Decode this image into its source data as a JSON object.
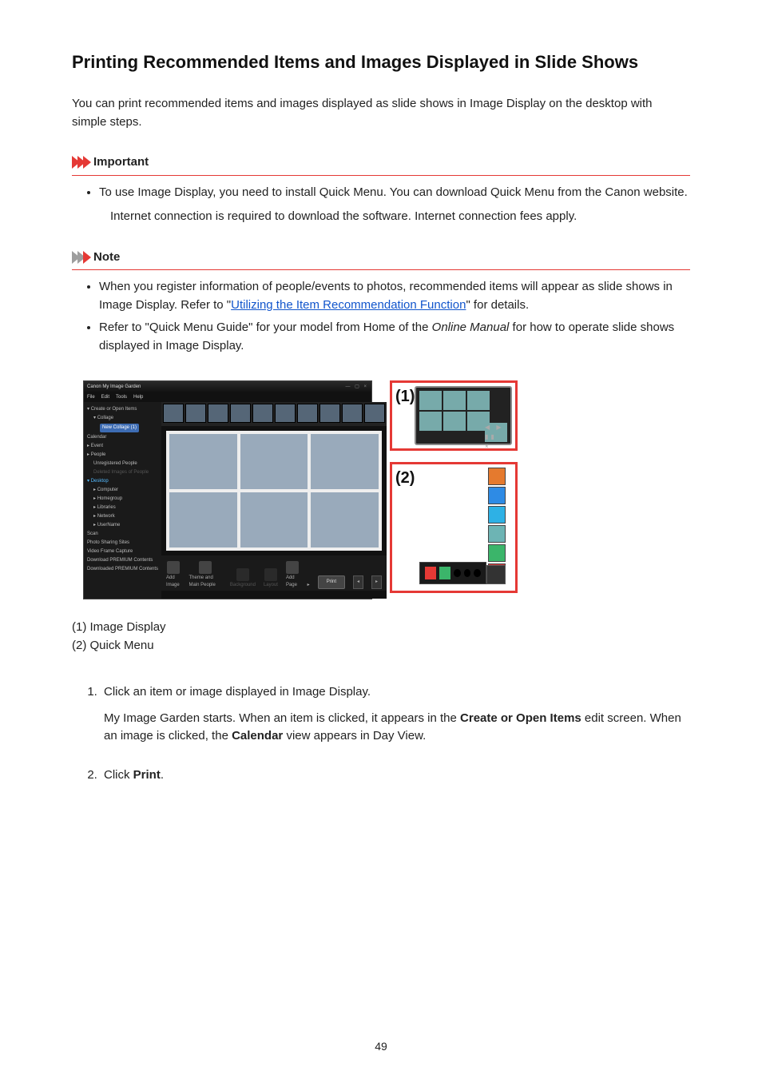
{
  "title": "Printing Recommended Items and Images Displayed in Slide Shows",
  "intro": "You can print recommended items and images displayed as slide shows in Image Display on the desktop with simple steps.",
  "important": {
    "label": "Important",
    "items": [
      "To use Image Display, you need to install Quick Menu. You can download Quick Menu from the Canon website."
    ],
    "extra": "Internet connection is required to download the software. Internet connection fees apply."
  },
  "note": {
    "label": "Note",
    "items": [
      {
        "pre": "When you register information of people/events to photos, recommended items will appear as slide shows in Image Display. Refer to \"",
        "link": "Utilizing the Item Recommendation Function",
        "post": "\" for details."
      },
      {
        "plain_pre": "Refer to \"Quick Menu Guide\" for your model from Home of the ",
        "italic": "Online Manual",
        "plain_post": " for how to operate slide shows displayed in Image Display."
      }
    ]
  },
  "app": {
    "title": "Canon My Image Garden",
    "winbtns": "— ▢ ×",
    "menus": [
      "File",
      "Edit",
      "Tools",
      "Help"
    ],
    "sidebar": {
      "create_open": "Create or Open Items",
      "collage": "Collage",
      "collage_active": "New Collage (1)",
      "calendar": "Calendar",
      "event": "Event",
      "people": "People",
      "unreg": "Unregistered People",
      "deleted": "Deleted Images of People",
      "desktop": "Desktop",
      "computer": "Computer",
      "homegroup": "Homegroup",
      "libraries": "Libraries",
      "network": "Network",
      "username": "UserName",
      "scan": "Scan",
      "sharing": "Photo Sharing Sites",
      "video": "Video Frame Capture",
      "dl_prem": "Download PREMIUM Contents",
      "dld_prem": "Downloaded PREMIUM Contents"
    },
    "toolbar": {
      "add_image": "Add Image",
      "theme": "Theme and Main People",
      "background": "Background",
      "layout": "Layout",
      "add_page": "Add Page",
      "arrow": "▸",
      "print": "Print"
    }
  },
  "callouts": {
    "one": "(1)",
    "two": "(2)"
  },
  "qmenu_colors": {
    "v": [
      "#e57a2e",
      "#2e8be5",
      "#2eb1e5",
      "#6db4b4",
      "#3bb56a",
      "#d93a3a"
    ],
    "hsq_red": "#e53935",
    "hsq_green": "#3bb56a"
  },
  "legend": {
    "one": "(1) Image Display",
    "two": "(2) Quick Menu"
  },
  "steps": [
    {
      "head": "Click an item or image displayed in Image Display.",
      "body_pre": "My Image Garden starts. When an item is clicked, it appears in the ",
      "b1": "Create or Open Items",
      "body_mid": " edit screen. When an image is clicked, the ",
      "b2": "Calendar",
      "body_post": " view appears in Day View."
    },
    {
      "head_pre": "Click ",
      "head_b": "Print",
      "head_post": "."
    }
  ],
  "page_number": "49"
}
